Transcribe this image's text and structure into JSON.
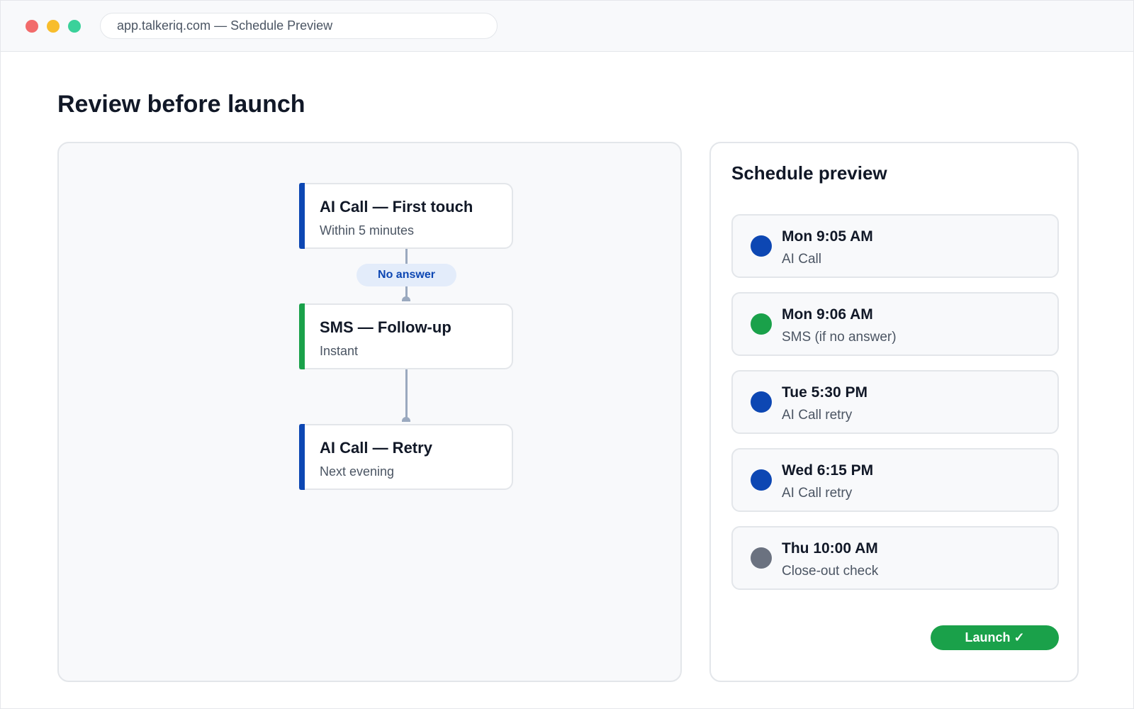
{
  "window": {
    "url_text": "app.talkeriq.com — Schedule Preview"
  },
  "page": {
    "title": "Review before launch"
  },
  "flow": {
    "nodes": [
      {
        "title": "AI Call — First touch",
        "subtitle": "Within 5 minutes",
        "accent": "#0d47b3"
      },
      {
        "title": "SMS — Follow-up",
        "subtitle": "Instant",
        "accent": "#1aa14a"
      },
      {
        "title": "AI Call — Retry",
        "subtitle": "Next evening",
        "accent": "#0d47b3"
      }
    ],
    "branch_label": "No answer"
  },
  "schedule": {
    "title": "Schedule preview",
    "items": [
      {
        "time": "Mon 9:05 AM",
        "desc": "AI Call",
        "color": "#0d47b3"
      },
      {
        "time": "Mon 9:06 AM",
        "desc": "SMS (if no answer)",
        "color": "#1aa14a"
      },
      {
        "time": "Tue 5:30 PM",
        "desc": "AI Call retry",
        "color": "#0d47b3"
      },
      {
        "time": "Wed 6:15 PM",
        "desc": "AI Call retry",
        "color": "#0d47b3"
      },
      {
        "time": "Thu 10:00 AM",
        "desc": "Close-out check",
        "color": "#6b7280"
      }
    ],
    "launch_label": "Launch ✓"
  },
  "colors": {
    "primary_blue": "#0d47b3",
    "success_green": "#1aa14a",
    "neutral_gray": "#6b7280"
  }
}
